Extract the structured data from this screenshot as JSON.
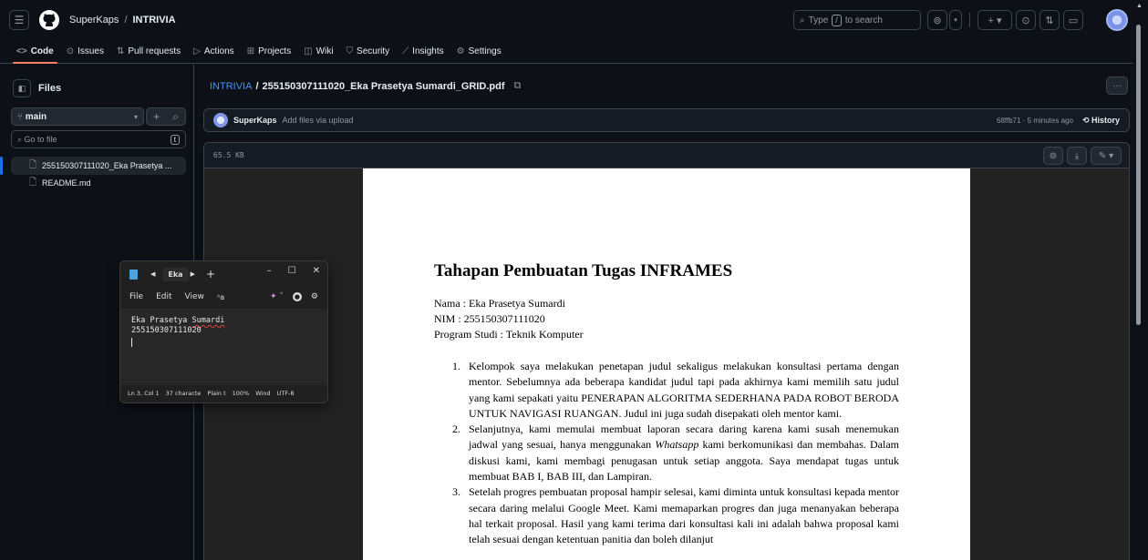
{
  "header": {
    "owner": "SuperKaps",
    "separator": "/",
    "repo": "INTRIVIA",
    "search_prefix": "Type",
    "search_key": "/",
    "search_suffix": "to search"
  },
  "repo_nav": {
    "tabs": [
      {
        "label": "Code",
        "icon": "<>"
      },
      {
        "label": "Issues",
        "icon": "⊙"
      },
      {
        "label": "Pull requests",
        "icon": "⇅"
      },
      {
        "label": "Actions",
        "icon": "▷"
      },
      {
        "label": "Projects",
        "icon": "⊞"
      },
      {
        "label": "Wiki",
        "icon": "◫"
      },
      {
        "label": "Security",
        "icon": "⛉"
      },
      {
        "label": "Insights",
        "icon": "⟋"
      },
      {
        "label": "Settings",
        "icon": "⚙"
      }
    ]
  },
  "sidebar": {
    "title": "Files",
    "branch": "main",
    "goto_placeholder": "Go to file",
    "goto_key": "t",
    "files": [
      {
        "name": "255150307111020_Eka Prasetya ...",
        "selected": true
      },
      {
        "name": "README.md",
        "selected": false
      }
    ]
  },
  "main": {
    "path_repo": "INTRIVIA",
    "path_sep": "/",
    "path_file": "255150307111020_Eka Prasetya Sumardi_GRID.pdf",
    "commit_user": "SuperKaps",
    "commit_message": "Add files via upload",
    "commit_meta": "68ffb71 · 5 minutes ago",
    "history_label": "History",
    "file_size": "65.5 KB"
  },
  "pdf": {
    "title": "Tahapan Pembuatan Tugas INFRAMES",
    "info": [
      "Nama : Eka Prasetya Sumardi",
      "NIM : 255150307111020",
      "Program Studi : Teknik Komputer"
    ],
    "items": [
      {
        "n": "1.",
        "text_a": "Kelompok saya melakukan penetapan judul sekaligus melakukan konsultasi pertama dengan mentor. Sebelumnya ada beberapa kandidat judul tapi pada akhirnya kami memilih satu judul yang kami sepakati yaitu PENERAPAN ALGORITMA SEDERHANA PADA ROBOT BERODA UNTUK NAVIGASI RUANGAN. Judul ini juga sudah disepakati oleh mentor kami.",
        "em": "",
        "text_b": ""
      },
      {
        "n": "2.",
        "text_a": "Selanjutnya, kami memulai membuat laporan secara daring karena kami susah menemukan jadwal yang sesuai, hanya menggunakan ",
        "em": "Whatsapp",
        "text_b": " kami berkomunikasi dan membahas. Dalam diskusi kami, kami membagi penugasan untuk setiap anggota. Saya mendapat tugas untuk membuat BAB I, BAB III, dan Lampiran."
      },
      {
        "n": "3.",
        "text_a": "Setelah progres pembuatan proposal hampir selesai, kami diminta untuk konsultasi kepada mentor secara daring melalui Google Meet. Kami memaparkan progres dan juga menanyakan beberapa hal terkait proposal. Hasil yang kami terima dari konsultasi kali ini adalah bahwa proposal kami telah sesuai dengan ketentuan panitia dan boleh dilanjut",
        "em": "",
        "text_b": ""
      }
    ]
  },
  "notepad": {
    "tab_label": "Eka",
    "menu": [
      "File",
      "Edit",
      "View"
    ],
    "line1_a": "Eka Prasetya ",
    "line1_b": "Sumardi",
    "line2": "255150307111020",
    "status": [
      "Ln 3, Col 1",
      "37 characte",
      "Plain t",
      "100%",
      "Wind",
      "UTF-8"
    ]
  },
  "colors": {
    "bg": "#0d1117",
    "border": "#3d444d",
    "link": "#4493f8",
    "active_underline": "#f78166",
    "selected_marker": "#1f6feb"
  }
}
